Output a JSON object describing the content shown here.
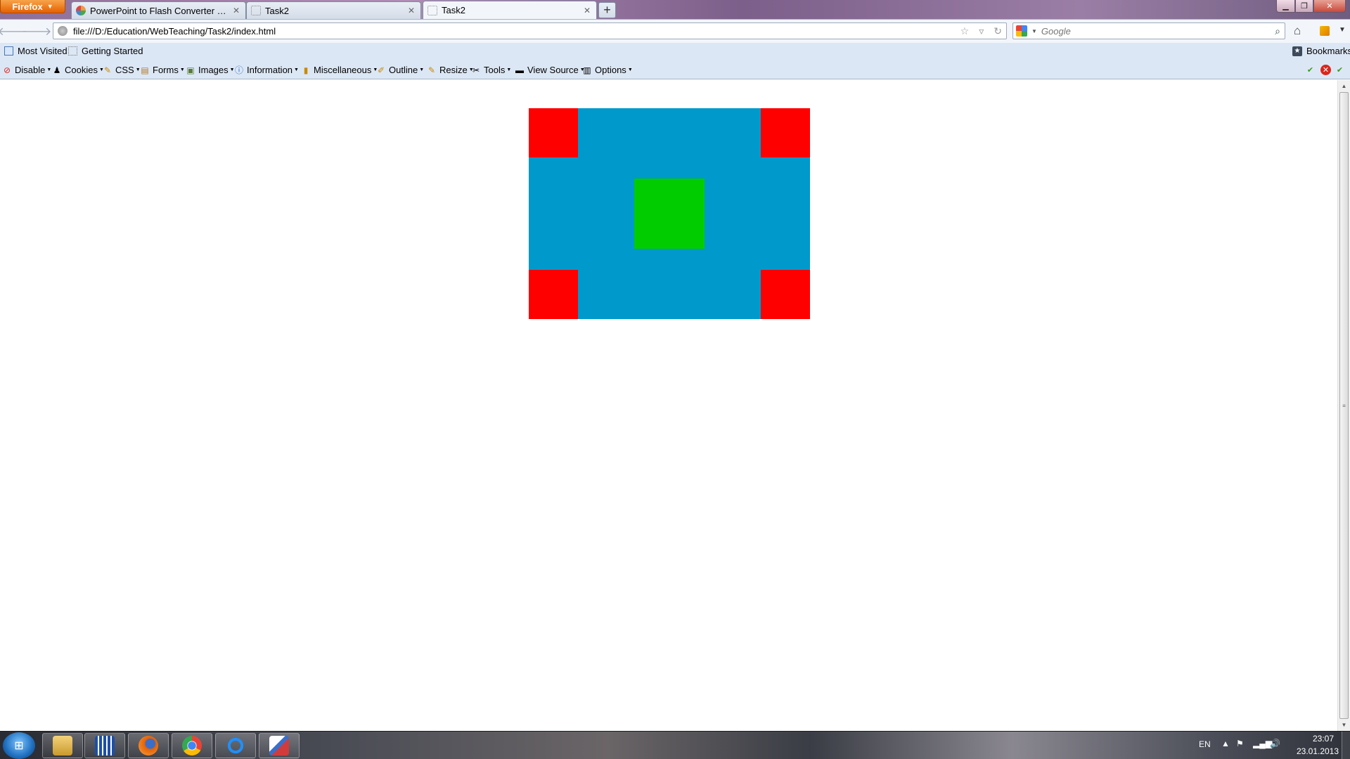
{
  "browser": {
    "menu_button": "Firefox",
    "tabs": [
      {
        "title": "PowerPoint to Flash Converter | Rapi..."
      },
      {
        "title": "Task2"
      },
      {
        "title": "Task2"
      }
    ],
    "new_tab_symbol": "+",
    "url": "file:///D:/Education/WebTeaching/Task2/index.html",
    "search_placeholder": "Google"
  },
  "bookmarks": {
    "items": [
      {
        "label": "Most Visited",
        "icon": "bookmark-folder-icon"
      },
      {
        "label": "Getting Started",
        "icon": "page-icon"
      }
    ],
    "right_label": "Bookmarks"
  },
  "webdev_toolbar": {
    "items": [
      {
        "label": "Disable",
        "icon": "disable-icon"
      },
      {
        "label": "Cookies",
        "icon": "cookies-icon"
      },
      {
        "label": "CSS",
        "icon": "css-icon"
      },
      {
        "label": "Forms",
        "icon": "forms-icon"
      },
      {
        "label": "Images",
        "icon": "images-icon"
      },
      {
        "label": "Information",
        "icon": "information-icon"
      },
      {
        "label": "Miscellaneous",
        "icon": "miscellaneous-icon"
      },
      {
        "label": "Outline",
        "icon": "outline-icon"
      },
      {
        "label": "Resize",
        "icon": "resize-icon"
      },
      {
        "label": "Tools",
        "icon": "tools-icon"
      },
      {
        "label": "View Source",
        "icon": "view-source-icon"
      },
      {
        "label": "Options",
        "icon": "options-icon"
      }
    ],
    "status_colors": {
      "ok": "#3b9b18",
      "error": "#d9261c"
    }
  },
  "page_content": {
    "outer_box_color": "#0099cc",
    "corner_color": "#ff0000",
    "center_color": "#00cc00"
  },
  "taskbar": {
    "apps": [
      "explorer-icon",
      "media-center-icon",
      "firefox-icon",
      "chrome-icon",
      "internet-explorer-icon",
      "paint-icon"
    ],
    "language": "EN",
    "time": "23:07",
    "date": "23.01.2013"
  }
}
